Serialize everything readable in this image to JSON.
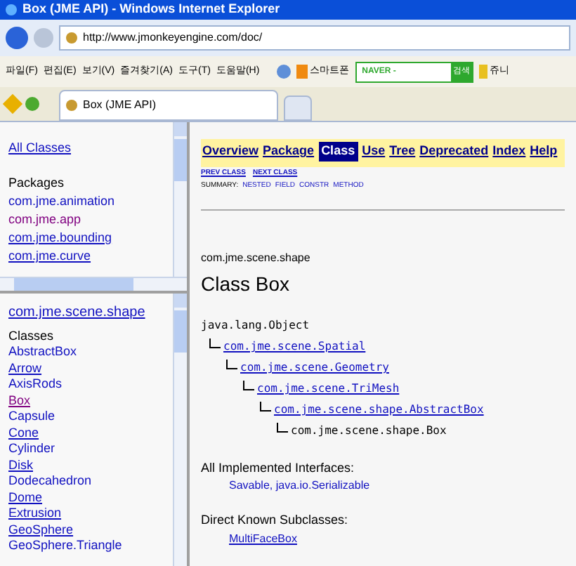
{
  "window": {
    "title": "Box (JME API) - Windows Internet Explorer"
  },
  "address_bar": {
    "url": "http://www.jmonkeyengine.com/doc/"
  },
  "menu": [
    "파일(F)",
    "편집(E)",
    "보기(V)",
    "즐겨찾기(A)",
    "도구(T)",
    "도움말(H)"
  ],
  "toolbar": {
    "shortcut": "스마트폰",
    "search_placeholder": "NAVER -",
    "search_button": "검색",
    "extra": "쥬니"
  },
  "tab": {
    "title": "Box (JME API)"
  },
  "packages_frame": {
    "all_classes": "All Classes",
    "heading": "Packages",
    "items": [
      {
        "label": "com.jme.animation",
        "visited": false,
        "underlined": false
      },
      {
        "label": "com.jme.app",
        "visited": true,
        "underlined": false
      },
      {
        "label": "com.jme.bounding",
        "visited": false,
        "underlined": true
      },
      {
        "label": "com.jme.curve",
        "visited": false,
        "underlined": true
      }
    ]
  },
  "classes_frame": {
    "package": "com.jme.scene.shape",
    "heading": "Classes",
    "items": [
      {
        "label": "AbstractBox",
        "visited": false,
        "underlined": false
      },
      {
        "label": "Arrow",
        "visited": false,
        "underlined": true
      },
      {
        "label": "AxisRods",
        "visited": false,
        "underlined": false
      },
      {
        "label": "Box",
        "visited": true,
        "underlined": true
      },
      {
        "label": "Capsule",
        "visited": false,
        "underlined": false
      },
      {
        "label": "Cone",
        "visited": false,
        "underlined": true
      },
      {
        "label": "Cylinder",
        "visited": false,
        "underlined": false
      },
      {
        "label": "Disk",
        "visited": false,
        "underlined": true
      },
      {
        "label": "Dodecahedron",
        "visited": false,
        "underlined": false
      },
      {
        "label": "Dome",
        "visited": false,
        "underlined": true
      },
      {
        "label": "Extrusion",
        "visited": false,
        "underlined": true
      },
      {
        "label": "GeoSphere",
        "visited": false,
        "underlined": true
      },
      {
        "label": "GeoSphere.Triangle",
        "visited": false,
        "underlined": false
      }
    ]
  },
  "navbar": [
    {
      "label": "Overview",
      "selected": false
    },
    {
      "label": "Package",
      "selected": false
    },
    {
      "label": "Class",
      "selected": true
    },
    {
      "label": "Use",
      "selected": false
    },
    {
      "label": "Tree",
      "selected": false
    },
    {
      "label": "Deprecated",
      "selected": false
    },
    {
      "label": "Index",
      "selected": false
    },
    {
      "label": "Help",
      "selected": false
    }
  ],
  "subnav": [
    "PREV CLASS",
    "NEXT CLASS"
  ],
  "summary_nav": [
    "SUMMARY:",
    "NESTED",
    "FIELD",
    "CONSTR",
    "METHOD"
  ],
  "package_name": "com.jme.scene.shape",
  "class_title": "Class Box",
  "hierarchy": {
    "label": "java.lang.Object",
    "link": false,
    "children": [
      {
        "label": "com.jme.scene.Spatial",
        "link": true,
        "children": [
          {
            "label": "com.jme.scene.Geometry",
            "link": true,
            "children": [
              {
                "label": "com.jme.scene.TriMesh",
                "link": true,
                "children": [
                  {
                    "label": "com.jme.scene.shape.AbstractBox",
                    "link": true,
                    "children": [
                      {
                        "label": "com.jme.scene.shape.Box",
                        "link": false
                      }
                    ]
                  }
                ]
              }
            ]
          }
        ]
      }
    ]
  },
  "interfaces": {
    "heading": "All Implemented Interfaces:",
    "value": "Savable, java.io.Serializable"
  },
  "subclasses": {
    "heading": "Direct Known Subclasses:",
    "value": "MultiFaceBox"
  }
}
